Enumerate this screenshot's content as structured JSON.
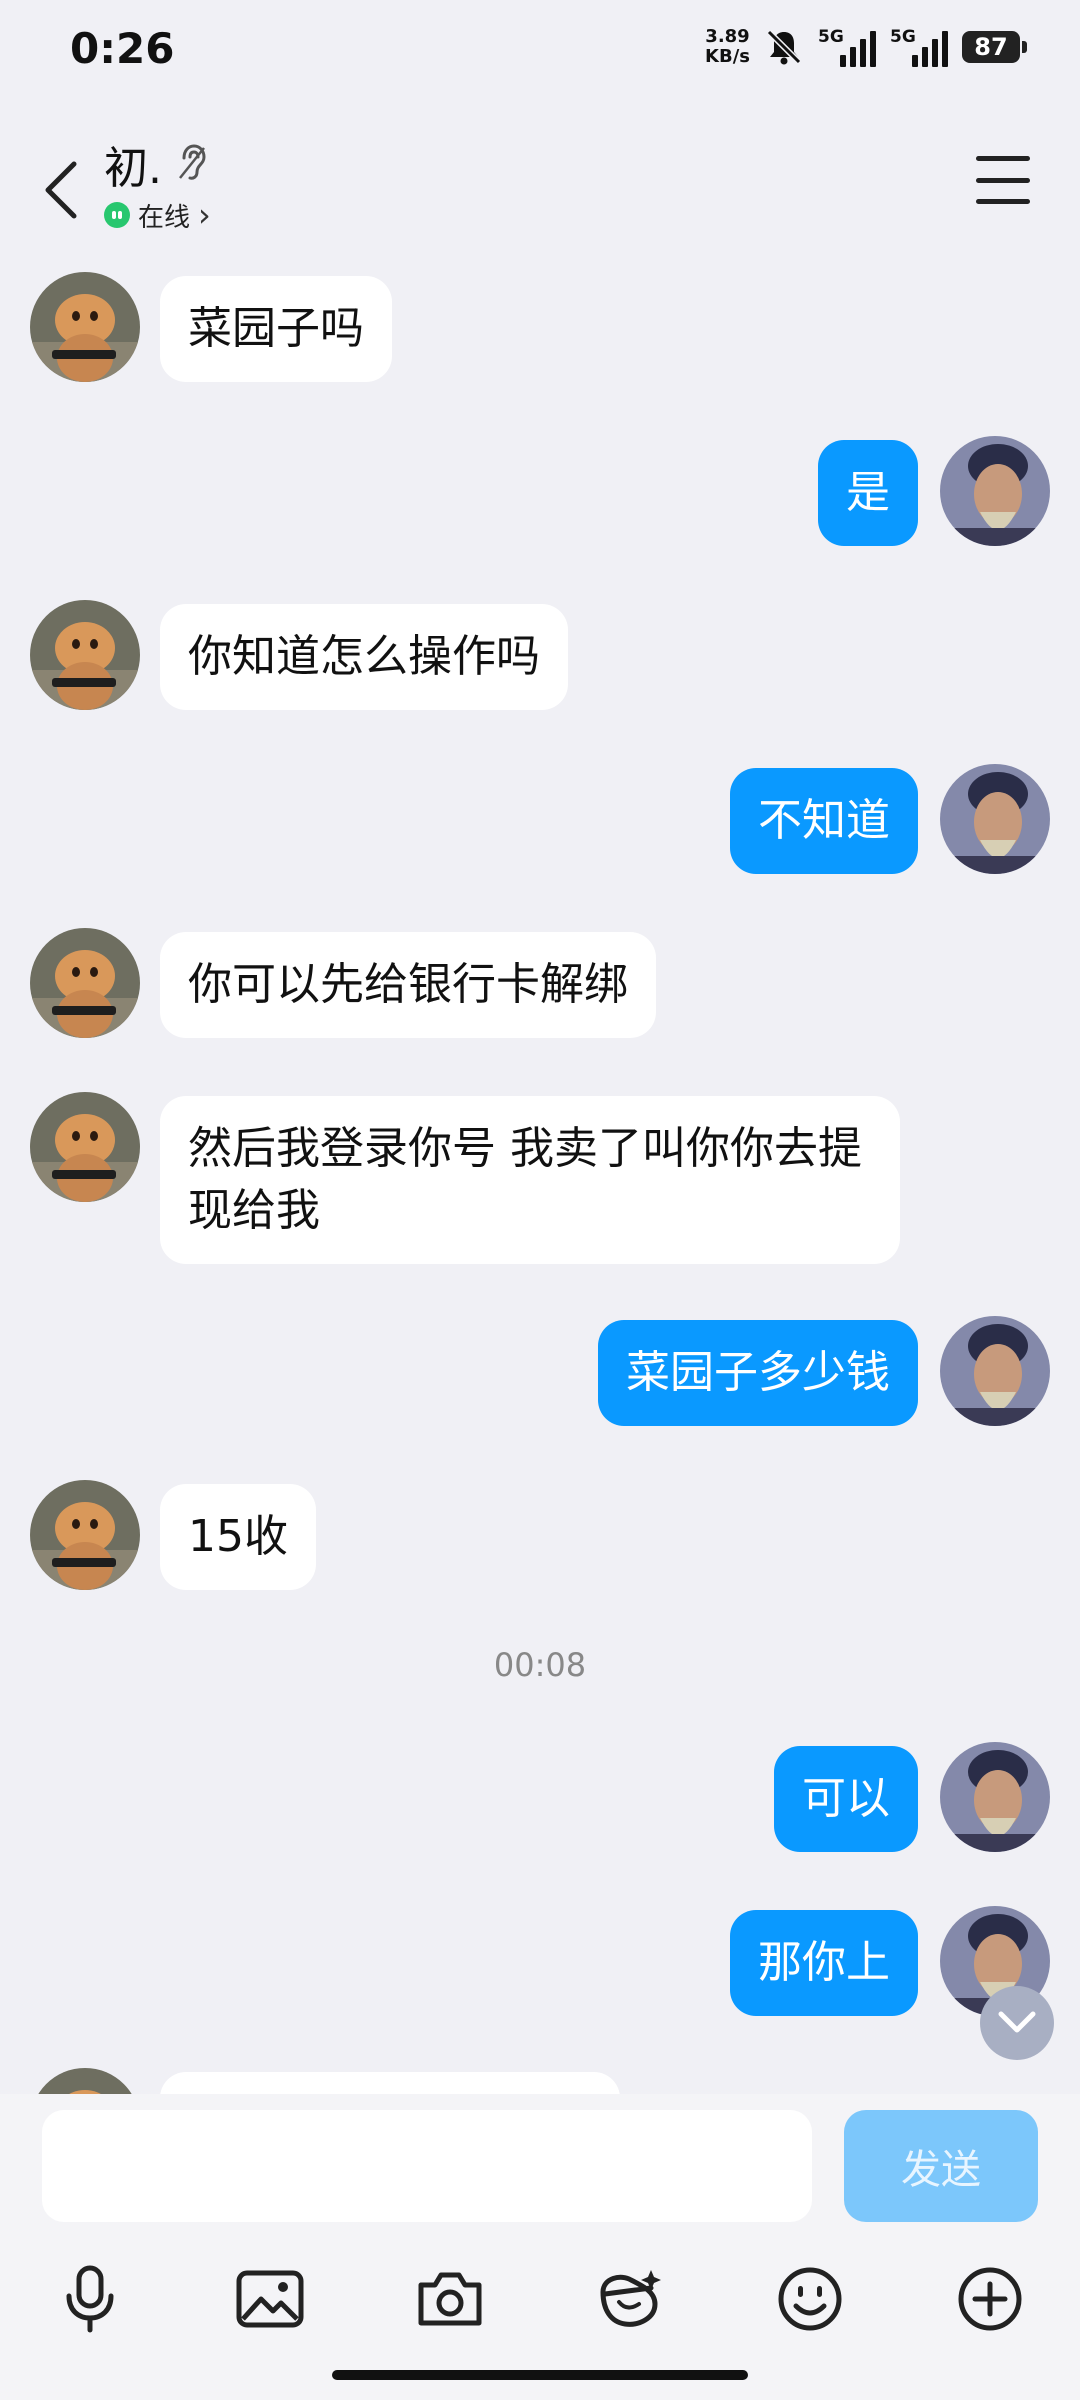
{
  "status_bar": {
    "time": "0:26",
    "net_speed_value": "3.89",
    "net_speed_unit": "KB/s",
    "sim1_label": "5G",
    "sim2_label": "5G",
    "battery": "87",
    "icons": [
      "bell-muted-icon",
      "signal-icon",
      "battery-icon"
    ]
  },
  "header": {
    "contact_name": "初.",
    "online_status": "在线",
    "chevron": "›"
  },
  "colors": {
    "outgoing_bubble": "#0a99ff",
    "incoming_bubble": "#ffffff",
    "background": "#f0f0f5",
    "send_button_disabled": "#7cc7fb",
    "online_green": "#28c76f"
  },
  "messages": [
    {
      "side": "incoming",
      "text": "菜园子吗"
    },
    {
      "side": "outgoing",
      "text": "是"
    },
    {
      "side": "incoming",
      "text": "你知道怎么操作吗"
    },
    {
      "side": "outgoing",
      "text": "不知道"
    },
    {
      "side": "incoming",
      "text": "你可以先给银行卡解绑"
    },
    {
      "side": "incoming",
      "text": "然后我登录你号 我卖了叫你你去提现给我"
    },
    {
      "side": "outgoing",
      "text": "菜园子多少钱"
    },
    {
      "side": "incoming",
      "text": "15收"
    },
    {
      "side": "outgoing",
      "text": "可以"
    },
    {
      "side": "outgoing",
      "text": "那你上"
    }
  ],
  "time_separator": "00:08",
  "input": {
    "value": "",
    "placeholder": "",
    "send_label": "发送"
  },
  "toolbar": {
    "icons": [
      "microphone-icon",
      "image-icon",
      "camera-icon",
      "red-packet-icon",
      "emoji-icon",
      "plus-icon"
    ]
  }
}
